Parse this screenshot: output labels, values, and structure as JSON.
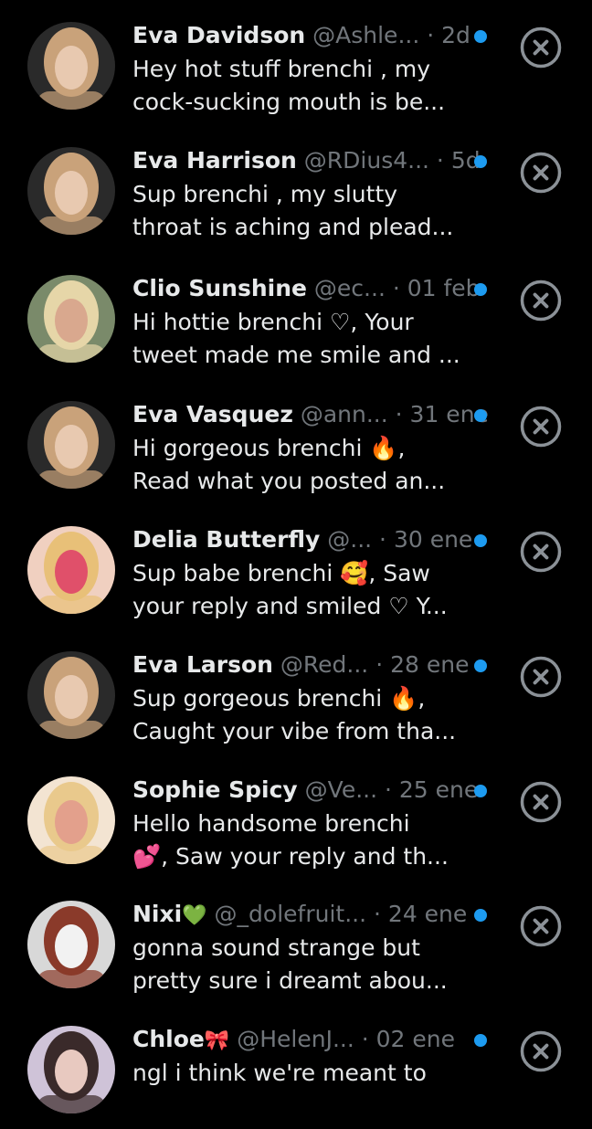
{
  "colors": {
    "background": "#000000",
    "primary_text": "#e7e9ea",
    "secondary_text": "#71767b",
    "unread_dot": "#1d9bf0",
    "close_icon": "#8b9197"
  },
  "messages": [
    {
      "name": "Eva Davidson",
      "name_emoji": "",
      "handle": "@Ashle...",
      "time": "· 2d",
      "line1": "Hey hot stuff brenchi  , my",
      "line2": "cock-sucking mouth is be...",
      "unread": true,
      "avatar_palette": [
        "#2a2a2a",
        "#c9a27a",
        "#e8c9b0"
      ]
    },
    {
      "name": "Eva Harrison",
      "name_emoji": "",
      "handle": "@RDius4...",
      "time": "· 5d",
      "line1": "Sup brenchi  , my slutty",
      "line2": "throat is aching and plead...",
      "unread": true,
      "avatar_palette": [
        "#2a2a2a",
        "#c9a27a",
        "#e8c9b0"
      ]
    },
    {
      "name": "Clio Sunshine",
      "name_emoji": "",
      "handle": "@ec...",
      "time": "· 01 feb",
      "line1": "Hi hottie brenchi ♡, Your",
      "line2": "tweet made me smile and ...",
      "unread": true,
      "avatar_palette": [
        "#7a8a6a",
        "#e6d6a8",
        "#d9a88e"
      ]
    },
    {
      "name": "Eva Vasquez",
      "name_emoji": "",
      "handle": "@ann...",
      "time": "· 31 ene",
      "line1": "Hi gorgeous brenchi 🔥,",
      "line2": "Read what you posted an...",
      "unread": true,
      "avatar_palette": [
        "#2a2a2a",
        "#c9a27a",
        "#e8c9b0"
      ]
    },
    {
      "name": "Delia Butterfly",
      "name_emoji": "",
      "handle": "@...",
      "time": "· 30 ene",
      "line1": "Sup babe brenchi 🥰, Saw",
      "line2": "your reply and smiled ♡ Y...",
      "unread": true,
      "avatar_palette": [
        "#f0d0c0",
        "#e8c078",
        "#e0506a"
      ]
    },
    {
      "name": "Eva Larson",
      "name_emoji": "",
      "handle": "@Red...",
      "time": "· 28 ene",
      "line1": "Sup gorgeous brenchi 🔥,",
      "line2": "Caught your vibe from tha...",
      "unread": true,
      "avatar_palette": [
        "#2a2a2a",
        "#c9a27a",
        "#e8c9b0"
      ]
    },
    {
      "name": "Sophie Spicy",
      "name_emoji": "",
      "handle": "@Ve...",
      "time": "· 25 ene",
      "line1": "Hello handsome brenchi",
      "line2": "💕, Saw your reply and th...",
      "unread": true,
      "avatar_palette": [
        "#f3e4d2",
        "#e9c98c",
        "#e3a08c"
      ]
    },
    {
      "name": "Nixi",
      "name_emoji": "💚",
      "handle": "@_dolefruit...",
      "time": "· 24 ene",
      "line1": "gonna sound strange but",
      "line2": "pretty sure i dreamt abou...",
      "unread": true,
      "avatar_palette": [
        "#d8d8d8",
        "#8a3a2a",
        "#f2f2f2"
      ]
    },
    {
      "name": "Chloe",
      "name_emoji": "🎀",
      "handle": "@HelenJ...",
      "time": "· 02 ene",
      "line1": "ngl i think we're meant to",
      "line2": "",
      "unread": true,
      "avatar_palette": [
        "#cfc3d8",
        "#3a2a2a",
        "#e8c9c0"
      ]
    }
  ]
}
